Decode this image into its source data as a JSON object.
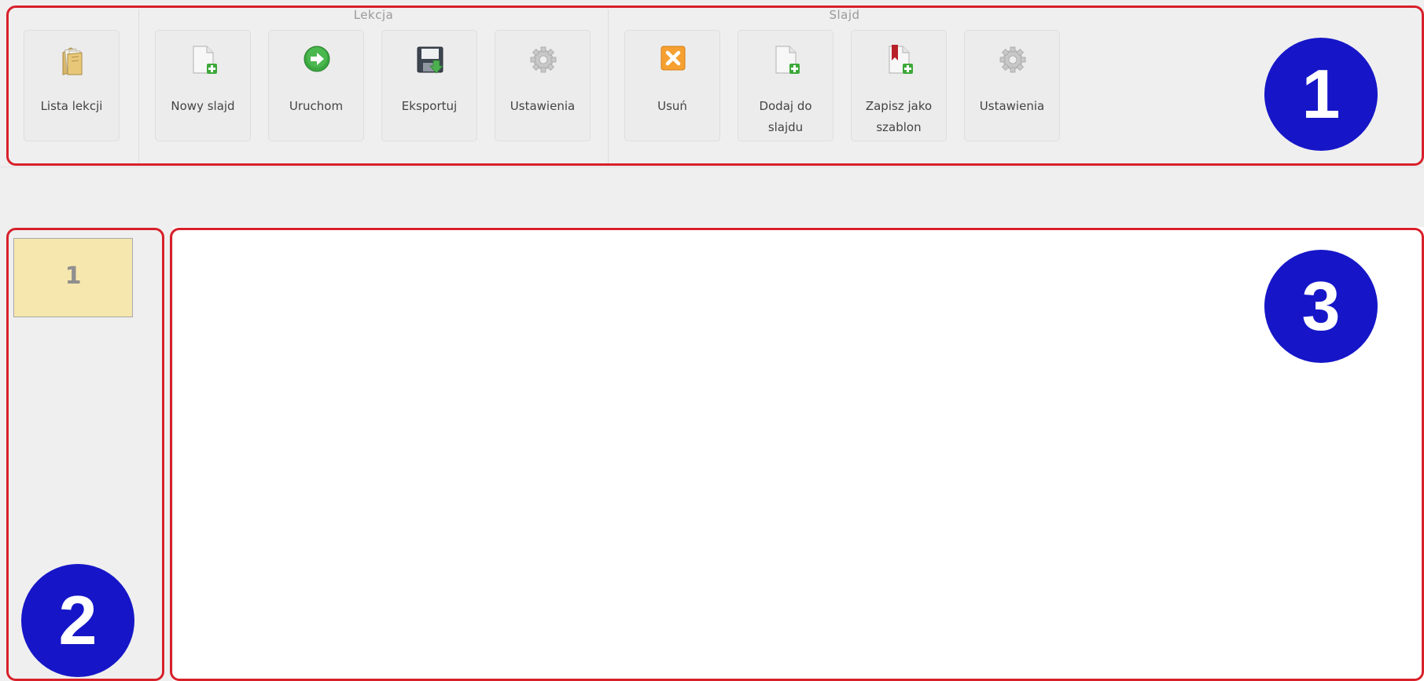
{
  "toolbar": {
    "lekcja_title": "Lekcja",
    "slajd_title": "Slajd",
    "lesson_list": {
      "label": "Lista lekcji",
      "icon": "folder-icon"
    },
    "lekcja_buttons": [
      {
        "label": "Nowy slajd",
        "icon": "new-slide-icon"
      },
      {
        "label": "Uruchom",
        "icon": "run-icon"
      },
      {
        "label": "Eksportuj",
        "icon": "export-icon"
      },
      {
        "label": "Ustawienia",
        "icon": "settings-icon"
      }
    ],
    "slajd_buttons": [
      {
        "label": "Usuń",
        "icon": "delete-icon"
      },
      {
        "label": "Dodaj do slajdu",
        "icon": "add-to-slide-icon"
      },
      {
        "label": "Zapisz jako szablon",
        "icon": "save-as-template-icon"
      },
      {
        "label": "Ustawienia",
        "icon": "settings-icon"
      }
    ]
  },
  "slides_panel": {
    "slides": [
      {
        "number": "1"
      }
    ]
  },
  "markers": {
    "toolbar": "1",
    "slides": "2",
    "canvas": "3"
  },
  "colors": {
    "frame": "#d8202a",
    "marker": "#1616c8",
    "thumbnail": "#f6e7ae",
    "background": "#efefef",
    "canvas": "#ffffff"
  }
}
